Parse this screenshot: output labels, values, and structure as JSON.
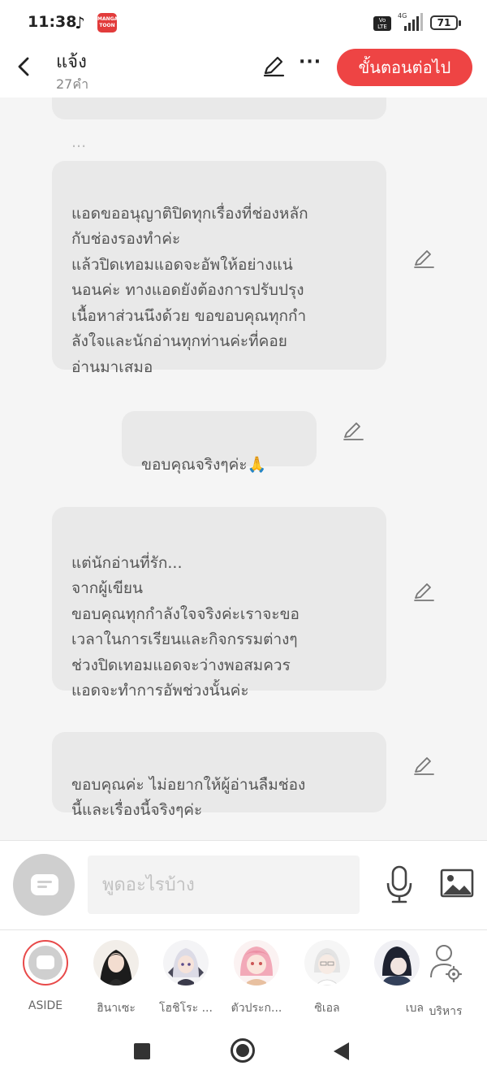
{
  "status_bar": {
    "time": "11:38",
    "battery": "71",
    "volte": "Vo LTE",
    "network": "4G"
  },
  "header": {
    "title": "แจ้ง",
    "subtitle": "27คำ",
    "next_button": "ขั้นตอนต่อไป"
  },
  "messages": [
    {
      "text": "..."
    },
    {
      "text": "แอดขออนุญาติปิดทุกเรื่องที่ช่องหลัก\nกับช่องรองทำค่ะ\nแล้วปิดเทอมแอดจะอัพให้อย่างแน่\nนอนค่ะ ทางแอดยังต้องการปรับปรุง\nเนื้อหาส่วนนึงด้วย ขอขอบคุณทุกกำ\nลังใจและนักอ่านทุกท่านค่ะที่คอย\nอ่านมาเสมอ"
    },
    {
      "text": "ขอบคุณจริงๆค่ะ🙏"
    },
    {
      "text": "แต่นักอ่านที่รัก...\nจากผู้เขียน\nขอบคุณทุกกำลังใจจริงค่ะเราจะขอ\nเวลาในการเรียนและกิจกรรมต่างๆ\nช่วงปิดเทอมแอดจะว่างพอสมควร\nแอดจะทำการอัพช่วงนั้นค่ะ"
    },
    {
      "text": "ขอบคุณค่ะ ไม่อยากให้ผู้อ่านลืมช่อง\nนี้และเรื่องนี้จริงๆค่ะ"
    }
  ],
  "input": {
    "placeholder": "พูดอะไรบ้าง",
    "value": ""
  },
  "characters": [
    {
      "name": "ASIDE"
    },
    {
      "name": "ฮินาเซะ"
    },
    {
      "name": "โฮชิโระ ..."
    },
    {
      "name": "ตัวประก..."
    },
    {
      "name": "ซิเอล"
    },
    {
      "name": "เบล"
    },
    {
      "name": "บริหาร"
    }
  ],
  "colors": {
    "accent": "#ee4444",
    "bubble": "#e9e9e9",
    "background": "#f5f5f5"
  },
  "icons": {
    "back": "chevron-left-icon",
    "edit": "pencil-icon",
    "more": "more-icon",
    "mic": "microphone-icon",
    "image": "image-icon",
    "manage": "user-settings-icon"
  }
}
